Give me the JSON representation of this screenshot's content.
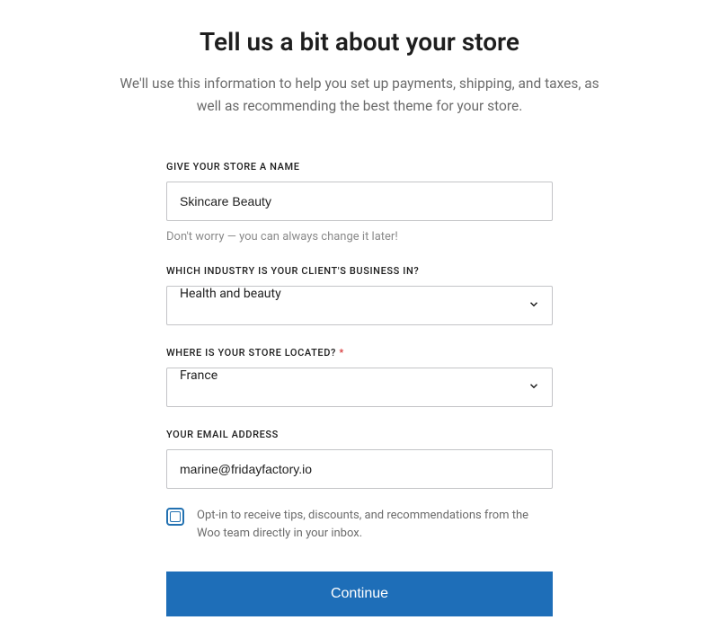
{
  "header": {
    "title": "Tell us a bit about your store",
    "subtitle": "We'll use this information to help you set up payments, shipping, and taxes, as well as recommending the best theme for your store."
  },
  "form": {
    "store_name": {
      "label": "GIVE YOUR STORE A NAME",
      "value": "Skincare Beauty",
      "helper": "Don't worry — you can always change it later!"
    },
    "industry": {
      "label": "WHICH INDUSTRY IS YOUR CLIENT'S BUSINESS IN?",
      "value": "Health and beauty"
    },
    "location": {
      "label": "WHERE IS YOUR STORE LOCATED?",
      "required_marker": "*",
      "value": "France"
    },
    "email": {
      "label": "YOUR EMAIL ADDRESS",
      "value": "marine@fridayfactory.io"
    },
    "optin": {
      "label": "Opt-in to receive tips, discounts, and recommendations from the Woo team directly in your inbox."
    },
    "continue_label": "Continue"
  }
}
